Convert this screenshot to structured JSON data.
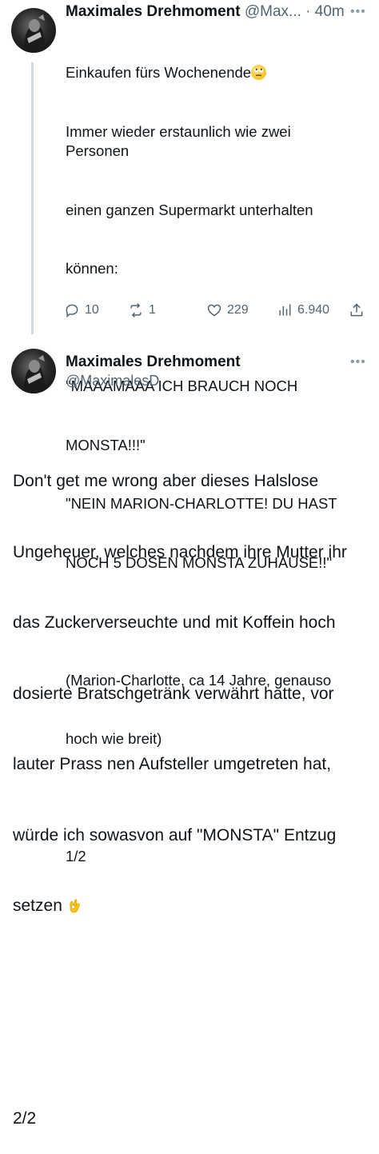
{
  "tweet1": {
    "name": "Maximales Drehmoment",
    "handle": "@Max...",
    "time": "· 40m",
    "lines": [
      "Einkaufen fürs Wochenende",
      "Immer wieder erstaunlich wie zwei Personen",
      "einen ganzen Supermarkt unterhalten",
      "können:",
      "",
      "\"MAAAMAAA ICH BRAUCH NOCH",
      "MONSTA!!!\"",
      "\"NEIN MARION-CHARLOTTE! DU HAST",
      "NOCH 5 DOSEN MONSTA ZUHAUSE!!\"",
      "",
      "(Marion-Charlotte, ca 14 Jahre, genauso",
      "hoch wie breit)",
      "",
      "1/2"
    ],
    "actions": {
      "replies": "10",
      "retweets": "1",
      "likes": "229",
      "views": "6.940"
    }
  },
  "tweet2": {
    "name": "Maximales Drehmoment",
    "handle": "@MaximalesD",
    "lines": [
      "Don't get me wrong aber dieses Halslose",
      "Ungeheuer, welches nachdem ihre Mutter ihr",
      "das Zuckerverseuchte und mit Koffein hoch",
      "dosierte Bratschgetränk verwährt hatte, vor",
      "lauter Prass nen Aufsteller umgetreten hat,",
      "würde ich sowasvon auf \"MONSTA\" Entzug",
      "setzen",
      "",
      "",
      "2/2"
    ]
  },
  "icons": {
    "more": "more-dots-icon",
    "reply": "reply-icon",
    "retweet": "retweet-icon",
    "like": "heart-icon",
    "views": "views-chart-icon",
    "share": "share-icon"
  }
}
